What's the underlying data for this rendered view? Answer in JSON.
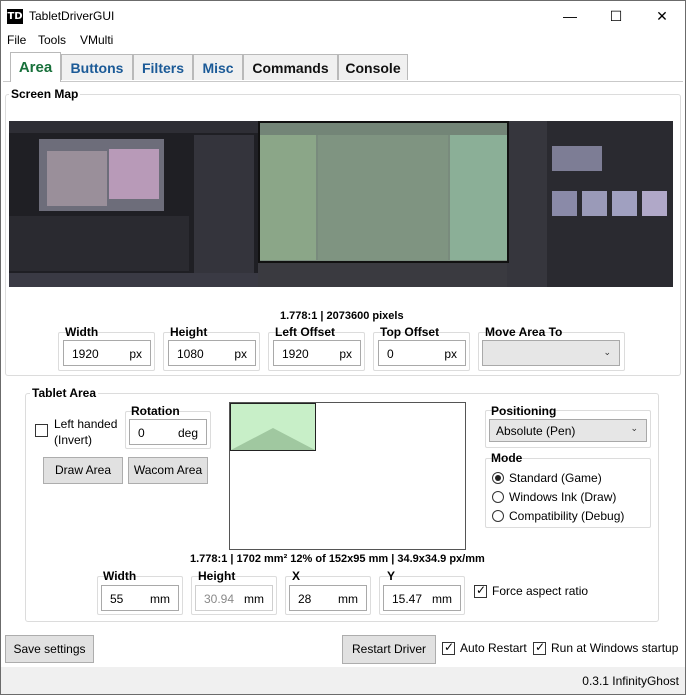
{
  "window": {
    "title": "TabletDriverGUI",
    "icon_text": "TD",
    "minimize": "—",
    "maximize": "☐",
    "close": "✕"
  },
  "menu": [
    "File",
    "Tools",
    "VMulti"
  ],
  "tabs": [
    "Area",
    "Buttons",
    "Filters",
    "Misc",
    "Commands",
    "Console"
  ],
  "screen_map": {
    "title": "Screen Map",
    "info": "1.778:1 | 2073600 pixels",
    "width_label": "Width",
    "width_value": "1920",
    "width_unit": "px",
    "height_label": "Height",
    "height_value": "1080",
    "height_unit": "px",
    "left_offset_label": "Left Offset",
    "left_offset_value": "1920",
    "left_offset_unit": "px",
    "top_offset_label": "Top Offset",
    "top_offset_value": "0",
    "top_offset_unit": "px",
    "move_area_label": "Move Area To",
    "move_area_value": ""
  },
  "tablet_area": {
    "title": "Tablet Area",
    "left_handed_label": "Left handed\n(Invert)",
    "left_handed_checked": false,
    "rotation_label": "Rotation",
    "rotation_value": "0",
    "rotation_unit": "deg",
    "draw_area_button": "Draw Area",
    "wacom_area_button": "Wacom Area",
    "positioning_label": "Positioning",
    "positioning_value": "Absolute (Pen)",
    "mode_label": "Mode",
    "modes": [
      {
        "label": "Standard (Game)",
        "selected": true
      },
      {
        "label": "Windows Ink (Draw)",
        "selected": false
      },
      {
        "label": "Compatibility (Debug)",
        "selected": false
      }
    ],
    "info": "1.778:1 | 1702 mm² 12% of 152x95 mm | 34.9x34.9 px/mm",
    "width_label": "Width",
    "width_value": "55",
    "width_unit": "mm",
    "height_label": "Height",
    "height_value": "30.94",
    "height_unit": "mm",
    "x_label": "X",
    "x_value": "28",
    "x_unit": "mm",
    "y_label": "Y",
    "y_value": "15.47",
    "y_unit": "mm",
    "force_aspect_label": "Force aspect ratio",
    "force_aspect_checked": true
  },
  "bottom": {
    "save_button": "Save settings",
    "restart_button": "Restart Driver",
    "auto_restart_label": "Auto Restart",
    "auto_restart_checked": true,
    "startup_label": "Run at Windows startup",
    "startup_checked": true
  },
  "status": {
    "version": "0.3.1 InfinityGhost"
  },
  "icons": {
    "check": "✓",
    "dropdown": "⌄"
  },
  "colors": {
    "active_tab_text": "#17703a",
    "tab_text": "#1b5a97",
    "area_fill": "#c8efc8",
    "monitor_bg": "#1f1f24"
  }
}
